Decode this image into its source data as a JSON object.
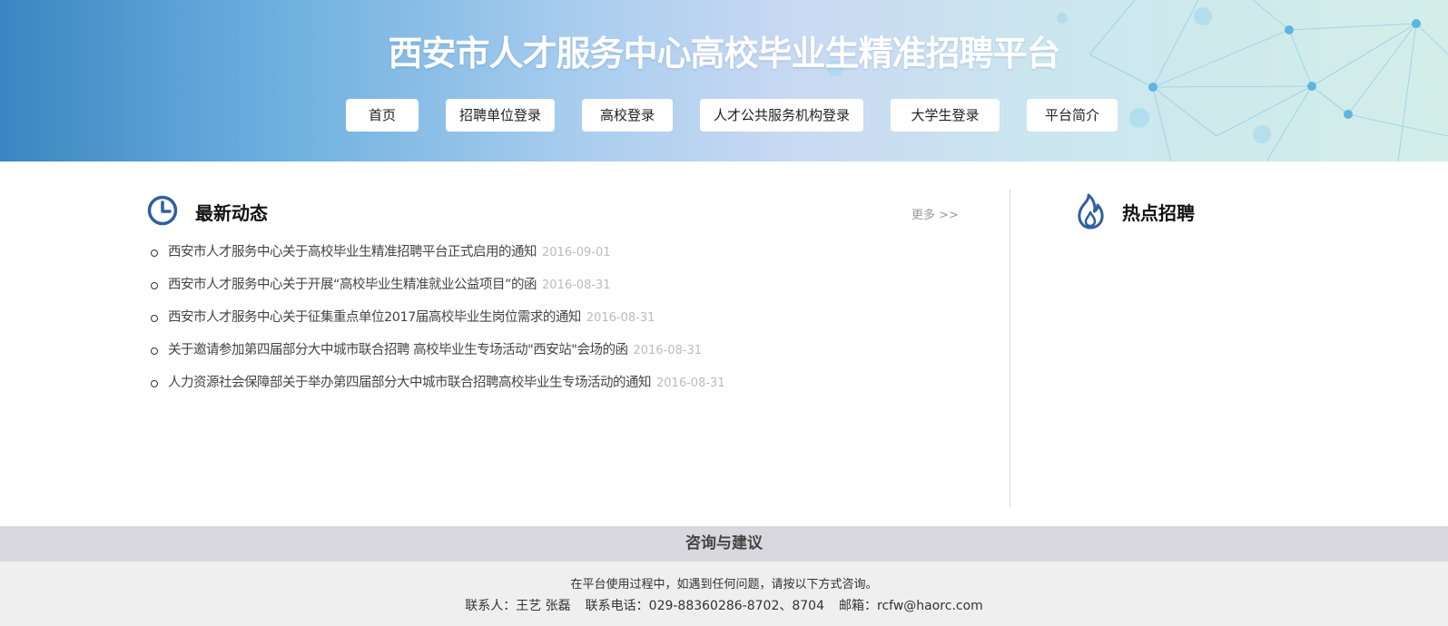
{
  "header": {
    "title": "西安市人才服务中心高校毕业生精准招聘平台",
    "nav": [
      {
        "label": "首页"
      },
      {
        "label": "招聘单位登录"
      },
      {
        "label": "高校登录"
      },
      {
        "label": "人才公共服务机构登录"
      },
      {
        "label": "大学生登录"
      },
      {
        "label": "平台简介"
      }
    ]
  },
  "news": {
    "icon": "clock-icon",
    "title": "最新动态",
    "more": "更多 >>",
    "items": [
      {
        "title": "西安市人才服务中心关于高校毕业生精准招聘平台正式启用的通知",
        "date": "2016-09-01"
      },
      {
        "title": "西安市人才服务中心关于开展“高校毕业生精准就业公益项目”的函",
        "date": "2016-08-31"
      },
      {
        "title": "西安市人才服务中心关于征集重点单位2017届高校毕业生岗位需求的通知",
        "date": "2016-08-31"
      },
      {
        "title": "关于邀请参加第四届部分大中城市联合招聘 高校毕业生专场活动\"西安站\"会场的函",
        "date": "2016-08-31"
      },
      {
        "title": "人力资源社会保障部关于举办第四届部分大中城市联合招聘高校毕业生专场活动的通知",
        "date": "2016-08-31"
      }
    ]
  },
  "hot": {
    "icon": "flame-icon",
    "title": "热点招聘"
  },
  "footer": {
    "title": "咨询与建议",
    "line1": "在平台使用过程中，如遇到任何问题，请按以下方式咨询。",
    "contact": "联系人：王艺 张磊",
    "phone": "联系电话：029-88360286-8702、8704",
    "email": "邮箱：rcfw@haorc.com"
  },
  "colors": {
    "accent": "#2f5f9e",
    "header_left": "#3a86c2",
    "header_right": "#d3eee9",
    "footer_head_bg": "#d8d8de",
    "footer_body_bg": "#efefef"
  }
}
